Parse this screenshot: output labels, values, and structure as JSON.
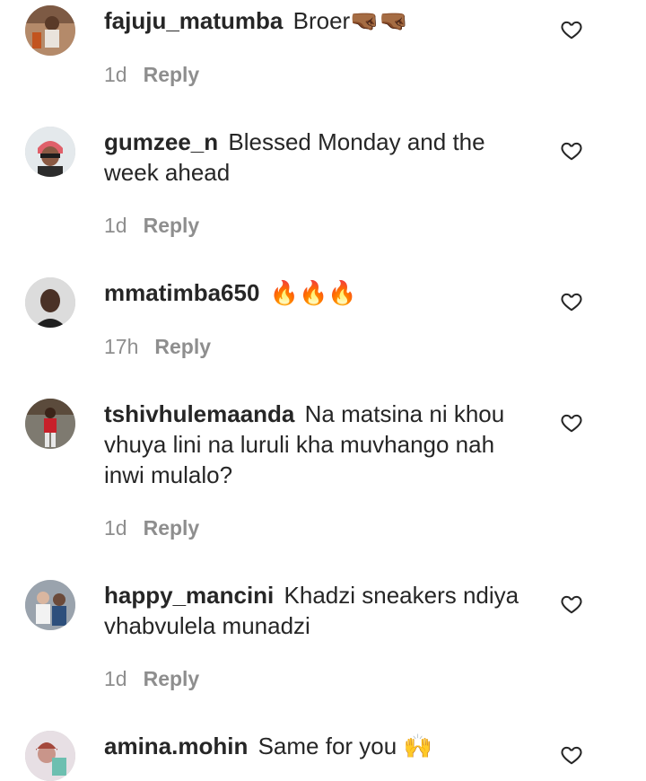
{
  "comments": [
    {
      "username": "fajuju_matumba",
      "text": "Broer",
      "emoji": "🤜🏾🤜🏾",
      "time": "1d",
      "reply_label": "Reply",
      "icon": "heart-outline-icon"
    },
    {
      "username": "gumzee_n",
      "text": "Blessed Monday and the week ahead",
      "emoji": "",
      "time": "1d",
      "reply_label": "Reply",
      "icon": "heart-outline-icon"
    },
    {
      "username": "mmatimba650",
      "text": "",
      "emoji": "🔥🔥🔥",
      "time": "17h",
      "reply_label": "Reply",
      "icon": "heart-outline-icon"
    },
    {
      "username": "tshivhulemaanda",
      "text": "Na matsina ni khou vhuya lini na luruli kha muvhango nah inwi mulalo?",
      "emoji": "",
      "time": "1d",
      "reply_label": "Reply",
      "icon": "heart-outline-icon"
    },
    {
      "username": "happy_mancini",
      "text": "Khadzi sneakers ndiya vhabvulela munadzi",
      "emoji": "",
      "time": "1d",
      "reply_label": "Reply",
      "icon": "heart-outline-icon"
    },
    {
      "username": "amina.mohin",
      "text": "Same for you",
      "emoji": "🙌",
      "time": "",
      "reply_label": "",
      "icon": "heart-outline-icon"
    }
  ],
  "colors": {
    "text": "#262626",
    "secondary": "#8e8e8e",
    "background": "#ffffff"
  }
}
